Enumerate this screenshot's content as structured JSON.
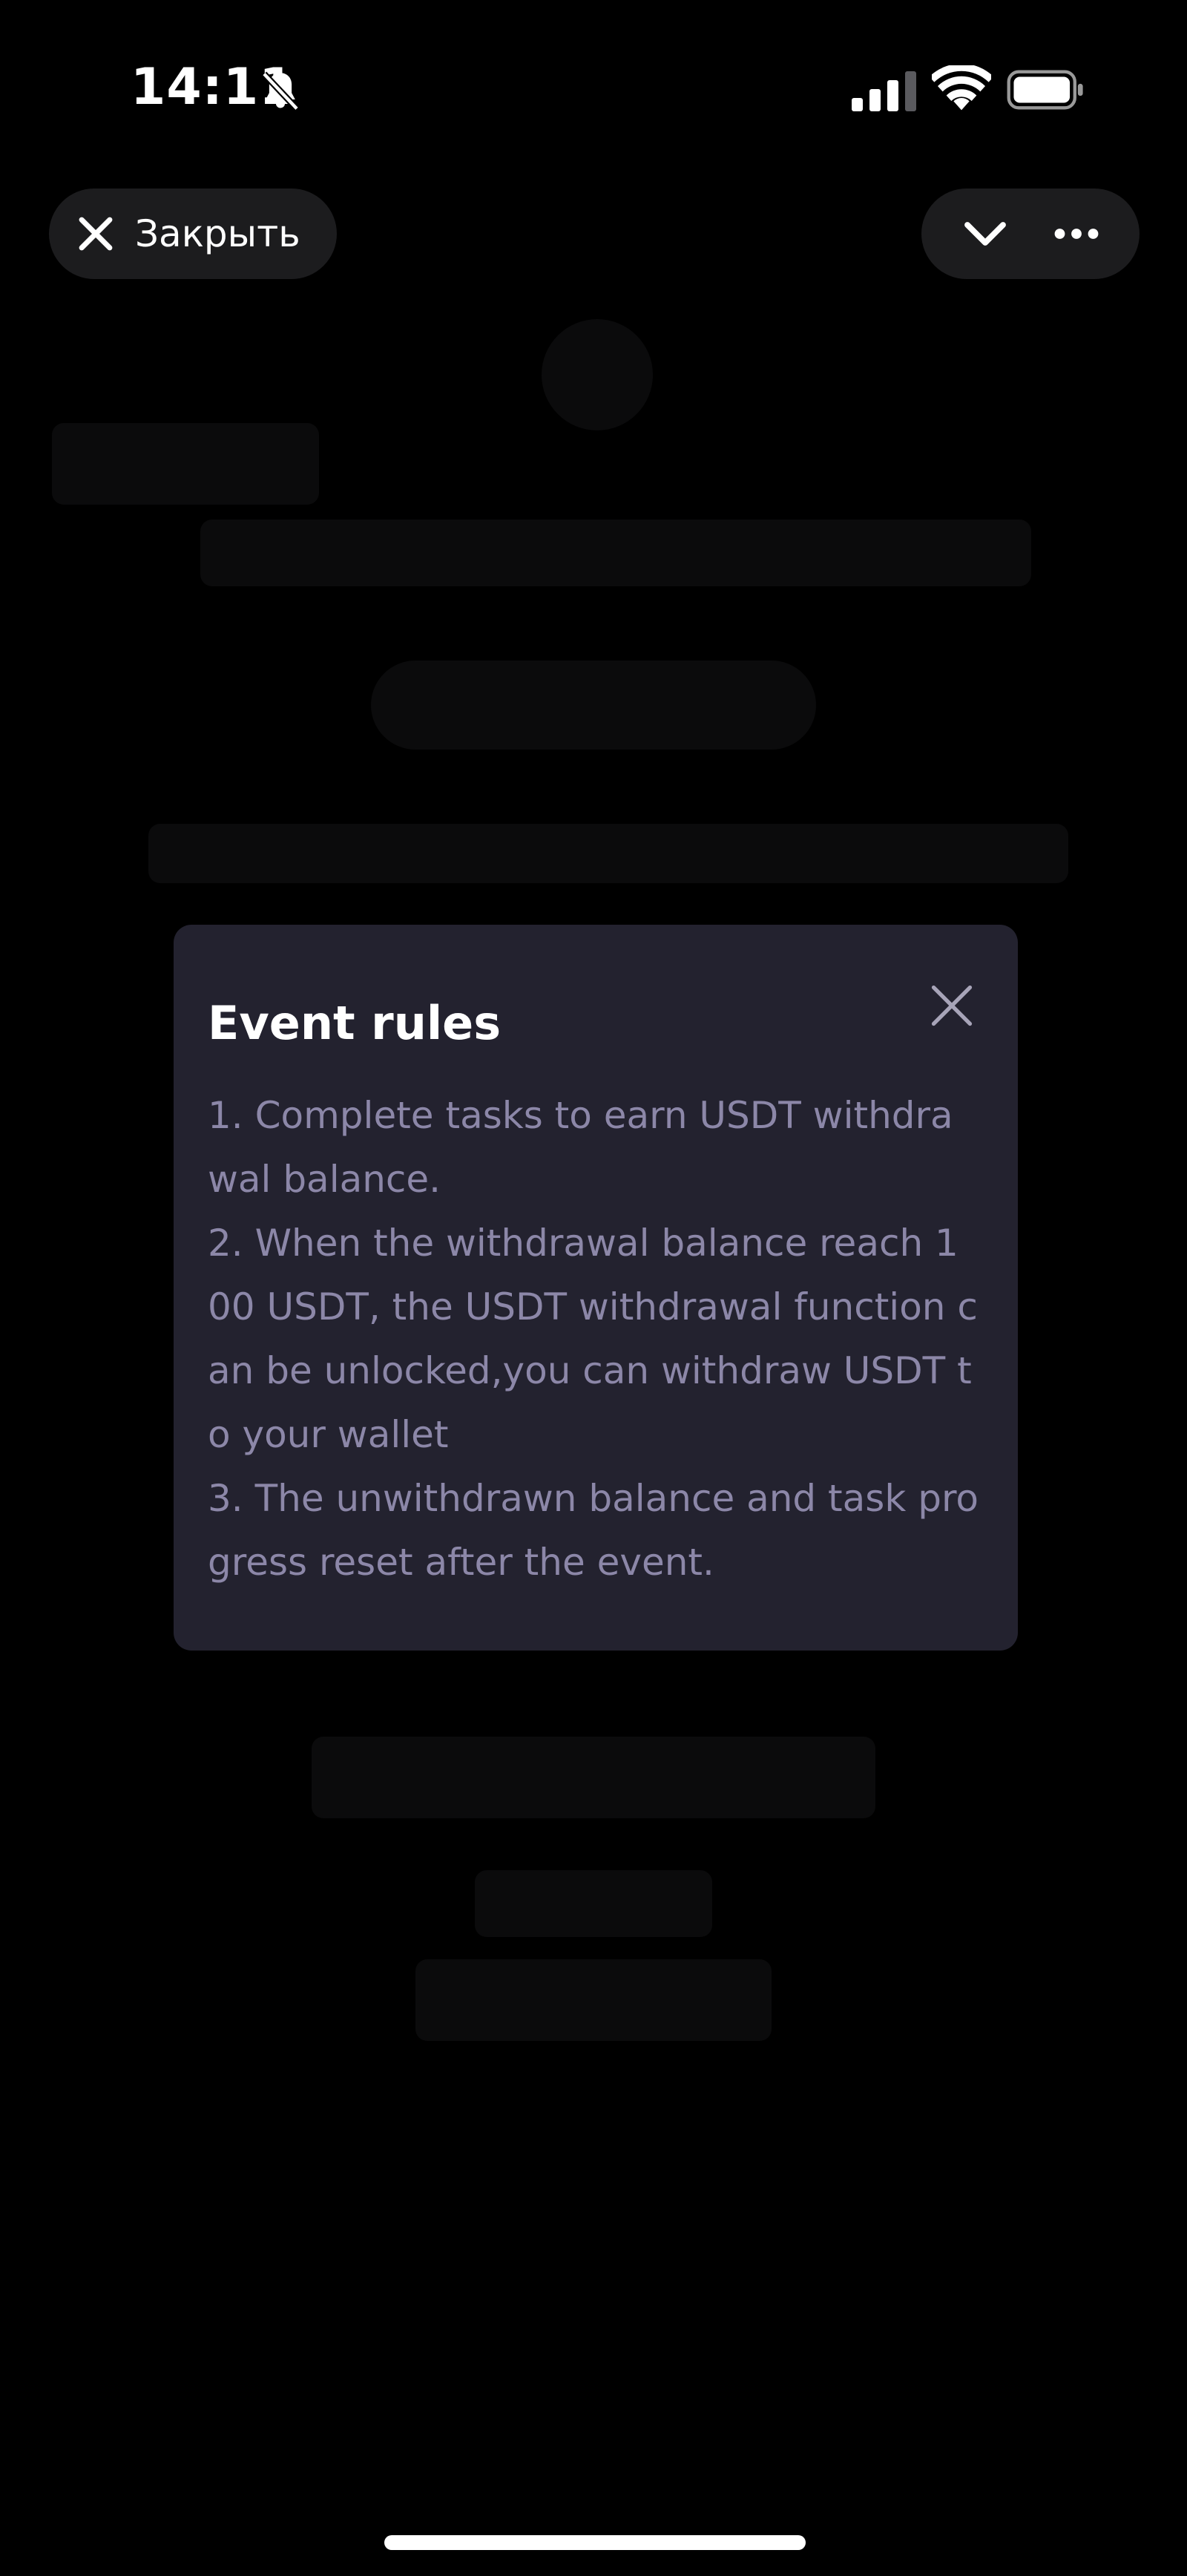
{
  "status_bar": {
    "time": "14:11",
    "icons": [
      "bell-slash-icon",
      "cellular-signal-icon",
      "wifi-icon",
      "battery-icon"
    ]
  },
  "top_bar": {
    "close_label": "Закрыть",
    "close_icon": "close-icon",
    "collapse_icon": "chevron-down-icon",
    "more_icon": "more-horizontal-icon"
  },
  "modal": {
    "title": "Event rules",
    "close_icon": "close-icon",
    "rules": [
      "1. Complete tasks to earn USDT withdrawal balance.",
      "2.  When the withdrawal balance reach 100 USDT, the USDT withdrawal function can be unlocked,you can withdraw USDT to your wallet",
      "3. The unwithdrawn balance and task progress reset after the event."
    ]
  },
  "colors": {
    "background": "#000000",
    "pill": "#1c1c1e",
    "modal_bg": "#23222f",
    "modal_title": "#ffffff",
    "modal_text": "#8c87a8"
  }
}
